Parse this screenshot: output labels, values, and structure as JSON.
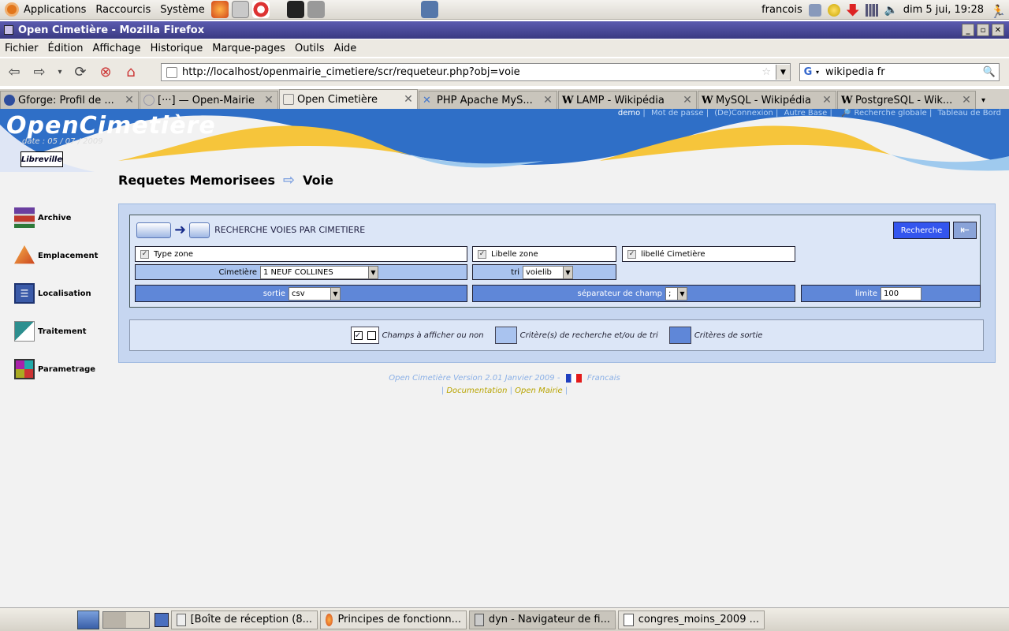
{
  "panel": {
    "menus": [
      "Applications",
      "Raccourcis",
      "Système"
    ],
    "user": "francois",
    "clock": "dim  5 jui, 19:28"
  },
  "window": {
    "title": "Open Cimetière - Mozilla Firefox",
    "menu": [
      "Fichier",
      "Édition",
      "Affichage",
      "Historique",
      "Marque-pages",
      "Outils",
      "Aide"
    ],
    "url": "http://localhost/openmairie_cimetiere/scr/requeteur.php?obj=voie",
    "search_value": "wikipedia fr",
    "tabs": [
      {
        "label": "Gforge: Profil de ..."
      },
      {
        "label": "[···] — Open-Mairie"
      },
      {
        "label": "Open Cimetière"
      },
      {
        "label": "PHP Apache MyS..."
      },
      {
        "label": "LAMP - Wikipédia"
      },
      {
        "label": "MySQL - Wikipédia"
      },
      {
        "label": "PostgreSQL - Wik..."
      }
    ]
  },
  "page": {
    "top_links": {
      "user": "demo",
      "items": [
        "Mot de passe",
        "(De)Connexion",
        "Autre Base",
        "Recherche globale",
        "Tableau de Bord"
      ]
    },
    "logo": "OpenCimetière",
    "date_line": "date : 05 / 07 / 2009",
    "ville": "Libreville",
    "sidebar": [
      "Archive",
      "Emplacement",
      "Localisation",
      "Traitement",
      "Parametrage"
    ],
    "breadcrumb": {
      "first": "Requetes Memorisees",
      "second": "Voie"
    },
    "form": {
      "header": "RECHERCHE  VOIES PAR CIMETIERE",
      "search_button": "Recherche",
      "back_button": "⇤",
      "checkbox_fields": [
        "Type zone",
        "Libelle zone",
        "libellé Cimetière"
      ],
      "cimetiere_label": "Cimetière",
      "cimetiere_value": "1 NEUF COLLINES",
      "tri_label": "tri",
      "tri_value": "voielib",
      "sortie_label": "sortie",
      "sortie_value": "csv",
      "separateur_label": "séparateur de champ",
      "separateur_value": ";",
      "limite_label": "limite",
      "limite_value": "100"
    },
    "legend": {
      "champs": "Champs à afficher ou non",
      "criteres": "Critère(s) de recherche et/ou de tri",
      "sortie": "Critères de sortie",
      "colors": {
        "criteres": "#a9c3ef",
        "sortie": "#5f87d8"
      }
    },
    "footer": {
      "version": "Open Cimetière  Version 2.01 Janvier 2009 -",
      "lang": "Francais",
      "doc": "Documentation",
      "mairie": "Open Mairie"
    }
  },
  "taskbar": {
    "tasks": [
      {
        "label": "[Boîte de réception (8..."
      },
      {
        "label": "Principes de fonctionn..."
      },
      {
        "label": "dyn - Navigateur de fi..."
      },
      {
        "label": "congres_moins_2009 ..."
      }
    ]
  }
}
